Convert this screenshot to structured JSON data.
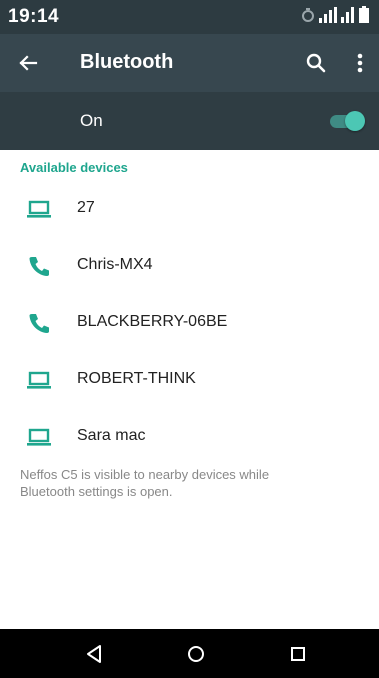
{
  "status_bar": {
    "time": "19:14",
    "icons": [
      "alarm-icon",
      "signal-icon",
      "signal-icon",
      "battery-icon"
    ]
  },
  "app_bar": {
    "title": "Bluetooth",
    "back_icon": "back-arrow-icon",
    "search_icon": "search-icon",
    "more_icon": "more-vert-icon"
  },
  "toggle": {
    "label": "On",
    "state": true
  },
  "available_devices": {
    "header": "Available devices",
    "devices": [
      {
        "name": "27",
        "icon": "laptop-icon"
      },
      {
        "name": "Chris-MX4",
        "icon": "phone-icon"
      },
      {
        "name": "BLACKBERRY-06BE",
        "icon": "phone-icon"
      },
      {
        "name": "ROBERT-THINK",
        "icon": "laptop-icon"
      },
      {
        "name": "Sara mac",
        "icon": "laptop-icon"
      }
    ]
  },
  "footer_note": "Neffos C5 is visible to nearby devices while Bluetooth settings is open.",
  "nav_bar": {
    "buttons": [
      "back-triangle-icon",
      "home-circle-icon",
      "recents-square-icon"
    ]
  },
  "colors": {
    "app_bar": "#37474f",
    "status_bar": "#2d3b41",
    "accent": "#1fa68e",
    "switch_thumb": "#4cc7b4"
  }
}
